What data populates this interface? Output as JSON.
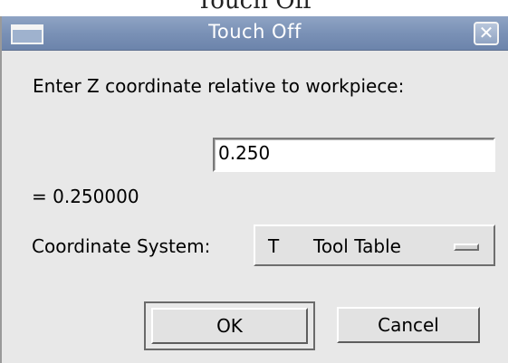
{
  "caption_above": "Touch Off",
  "window": {
    "title": "Touch Off",
    "close_glyph": "✕"
  },
  "dialog": {
    "prompt": "Enter Z coordinate relative to workpiece:",
    "entry_value": "0.250",
    "result": "= 0.250000",
    "coord_label": "Coordinate System:",
    "coord_code": "T",
    "coord_name": "Tool Table",
    "ok_label": "OK",
    "cancel_label": "Cancel"
  },
  "icons": {
    "window": "window-icon",
    "close": "close-icon",
    "dropdown": "option-menu-indicator-icon"
  }
}
